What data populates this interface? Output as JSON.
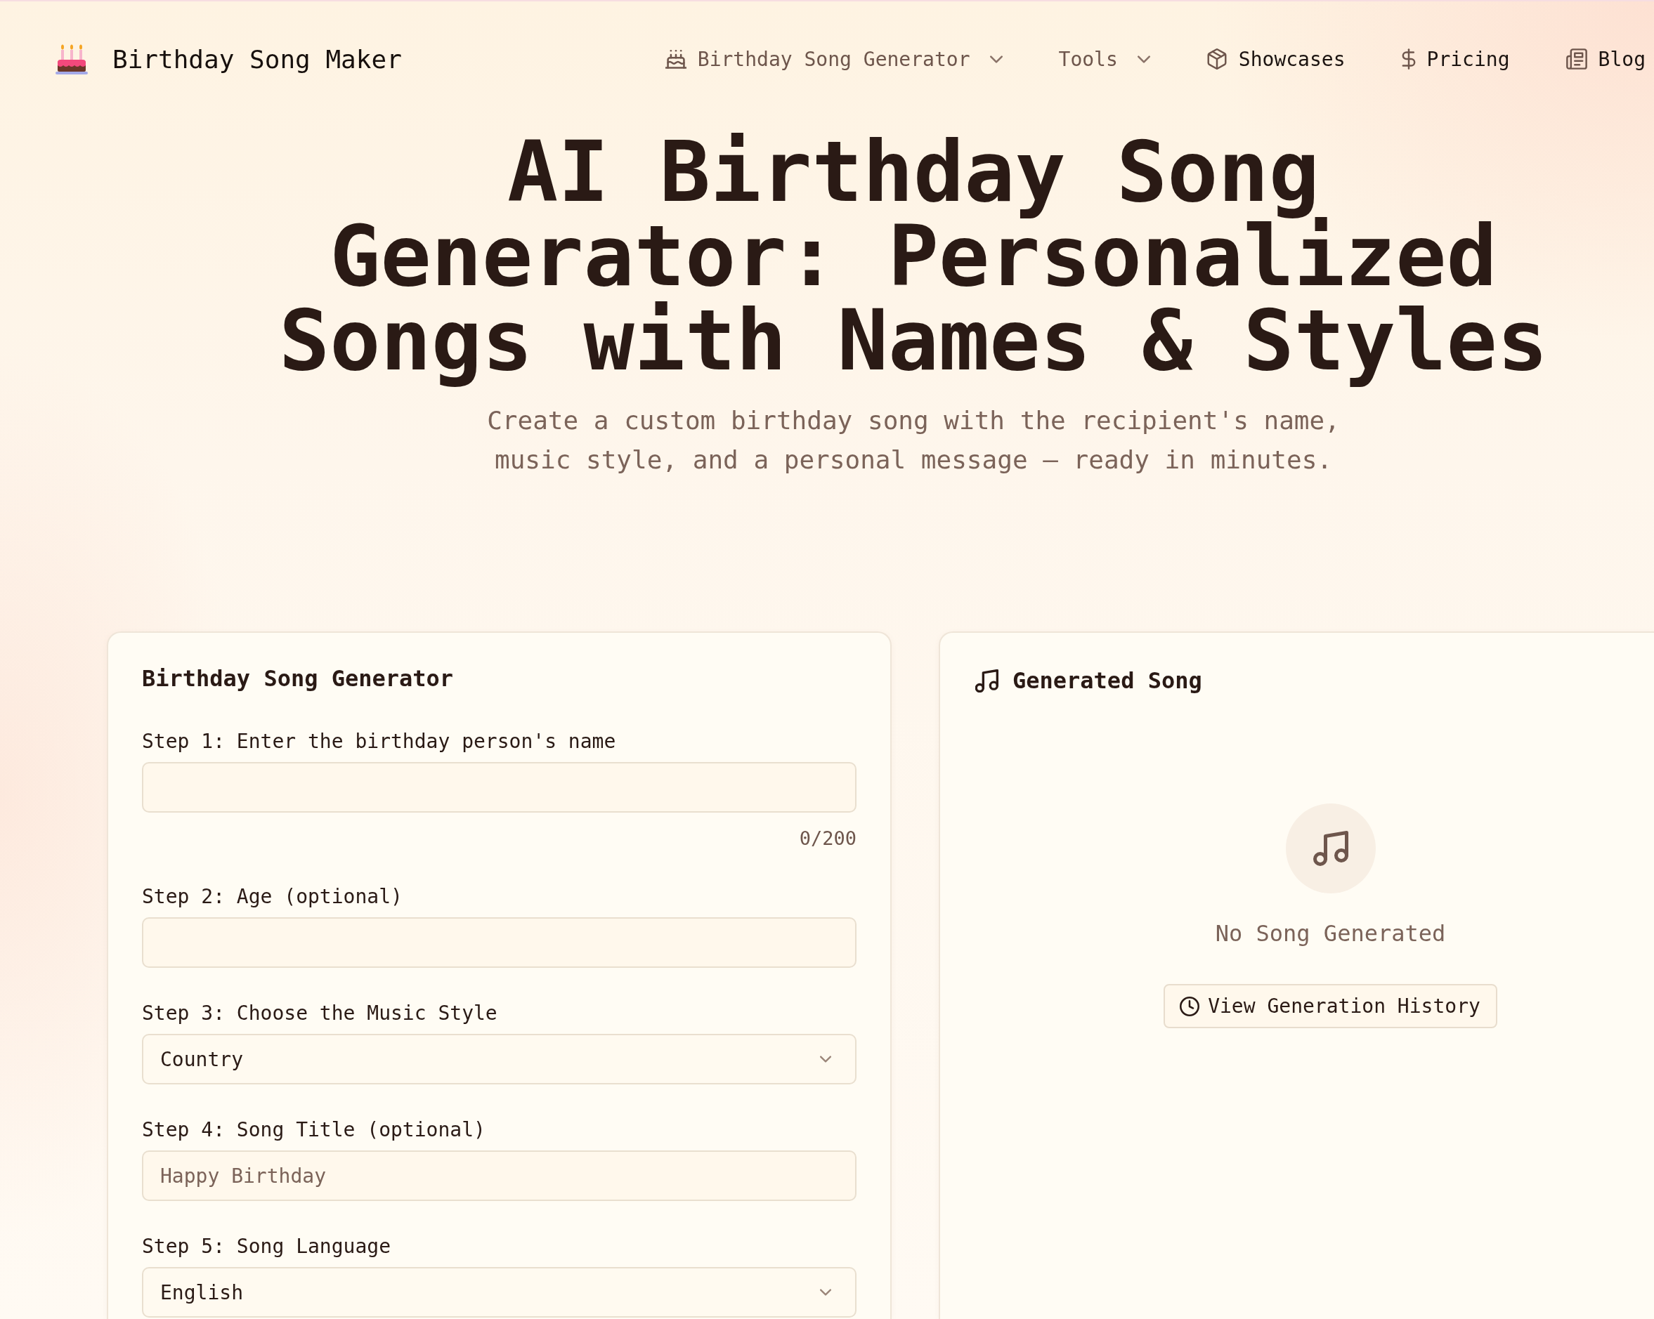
{
  "header": {
    "brand": "Birthday Song Maker",
    "nav": [
      {
        "label": "Birthday Song Generator",
        "kind": "dropdown"
      },
      {
        "label": "Tools",
        "kind": "dropdown"
      },
      {
        "label": "Showcases",
        "kind": "link"
      },
      {
        "label": "Pricing",
        "kind": "link"
      },
      {
        "label": "Blog",
        "kind": "link"
      }
    ]
  },
  "hero": {
    "title": "AI Birthday Song Generator: Personalized Songs with Names & Styles",
    "subtitle": "Create a custom birthday song with the recipient's name, music style, and a personal message — ready in minutes."
  },
  "generator_form": {
    "title": "Birthday Song Generator",
    "fields": [
      {
        "kind": "text",
        "label": "Step 1: Enter the birthday person's name",
        "counter": "0/200"
      },
      {
        "kind": "text",
        "label": "Step 2: Age (optional)"
      },
      {
        "kind": "select",
        "label": "Step 3: Choose the Music Style",
        "value": "Country"
      },
      {
        "kind": "text",
        "label": "Step 4: Song Title (optional)",
        "placeholder": "Happy Birthday"
      },
      {
        "kind": "select",
        "label": "Step 5: Song Language",
        "value": "English"
      }
    ]
  },
  "result_panel": {
    "title": "Generated Song",
    "empty_message": "No Song Generated",
    "history_button": "View Generation History"
  }
}
